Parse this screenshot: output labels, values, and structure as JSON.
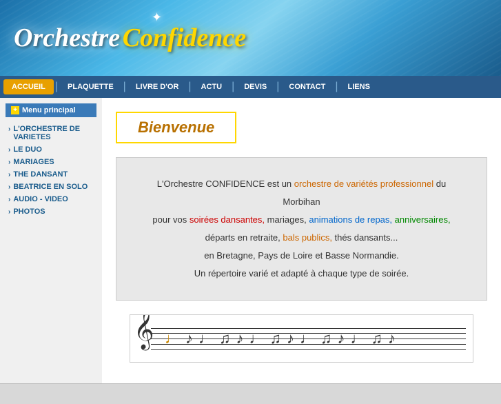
{
  "header": {
    "logo_part1": "Orchestre",
    "logo_part2": "Confidence"
  },
  "nav": {
    "items": [
      {
        "label": "ACCUEIL",
        "active": true
      },
      {
        "label": "PLAQUETTE",
        "active": false
      },
      {
        "label": "LIVRE D'OR",
        "active": false
      },
      {
        "label": "ACTU",
        "active": false
      },
      {
        "label": "DEVIS",
        "active": false
      },
      {
        "label": "CONTACT",
        "active": false
      },
      {
        "label": "LIENS",
        "active": false
      }
    ]
  },
  "sidebar": {
    "header": "Menu principal",
    "items": [
      {
        "label": "L'ORCHESTRE DE VARIETES"
      },
      {
        "label": "LE DUO"
      },
      {
        "label": "MARIAGES"
      },
      {
        "label": "THE DANSANT"
      },
      {
        "label": "BEATRICE EN SOLO"
      },
      {
        "label": "AUDIO - VIDEO"
      },
      {
        "label": "PHOTOS"
      }
    ]
  },
  "main": {
    "welcome": "Bienvenue",
    "description_lines": [
      {
        "parts": [
          {
            "text": "L'Orchestre CONFIDENCE est un ",
            "style": "normal"
          },
          {
            "text": "orchestre de variétés professionnel",
            "style": "orange"
          },
          {
            "text": " du Morbihan",
            "style": "normal"
          }
        ]
      },
      {
        "parts": [
          {
            "text": "pour vos ",
            "style": "normal"
          },
          {
            "text": "soirées dansantes,",
            "style": "red"
          },
          {
            "text": " mariages, ",
            "style": "normal"
          },
          {
            "text": "animations de repas,",
            "style": "blue"
          },
          {
            "text": " anniversaires,",
            "style": "green"
          }
        ]
      },
      {
        "parts": [
          {
            "text": "départs en retraite, ",
            "style": "normal"
          },
          {
            "text": "bals publics,",
            "style": "orange"
          },
          {
            "text": " thés dansants...",
            "style": "normal"
          }
        ]
      },
      {
        "parts": [
          {
            "text": "en Bretagne, Pays de Loire et Basse Normandie.",
            "style": "normal"
          }
        ]
      },
      {
        "parts": [
          {
            "text": "Un répertoire varié et adapté à chaque type de soirée.",
            "style": "normal"
          }
        ]
      }
    ]
  }
}
